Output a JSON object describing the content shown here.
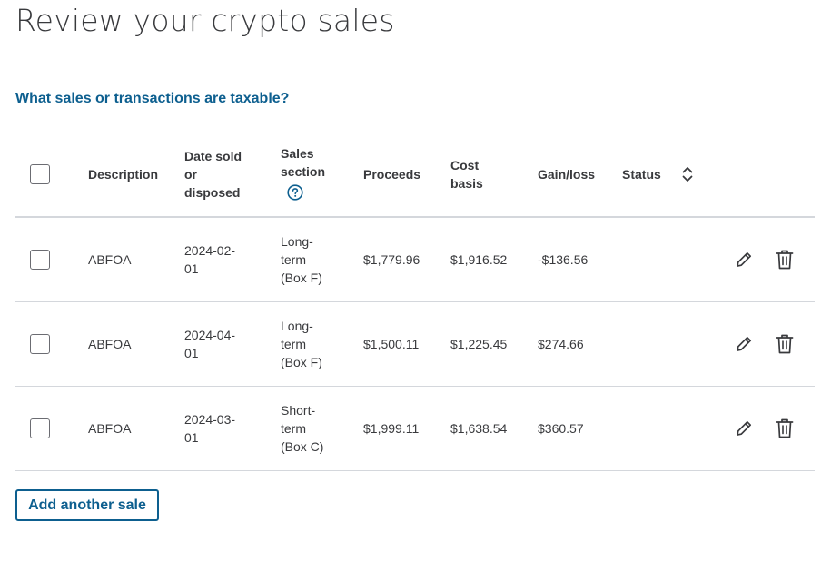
{
  "page": {
    "title": "Review your crypto sales",
    "help_link": "What sales or transactions are taxable?"
  },
  "table": {
    "columns": {
      "description": "Description",
      "date_sold_line1": "Date sold",
      "date_sold_line2": "or",
      "date_sold_line3": "disposed",
      "sales_section_line1": "Sales",
      "sales_section_line2": "section",
      "proceeds": "Proceeds",
      "cost_basis_line1": "Cost",
      "cost_basis_line2": "basis",
      "gain_loss": "Gain/loss",
      "status": "Status"
    },
    "rows": [
      {
        "description": "ABFOA",
        "date_line1": "2024-02-",
        "date_line2": "01",
        "section_line1": "Long-",
        "section_line2": "term",
        "section_line3": "(Box F)",
        "proceeds": "$1,779.96",
        "cost_basis": "$1,916.52",
        "gain_loss": "-$136.56",
        "status": ""
      },
      {
        "description": "ABFOA",
        "date_line1": "2024-04-",
        "date_line2": "01",
        "section_line1": "Long-",
        "section_line2": "term",
        "section_line3": "(Box F)",
        "proceeds": "$1,500.11",
        "cost_basis": "$1,225.45",
        "gain_loss": "$274.66",
        "status": ""
      },
      {
        "description": "ABFOA",
        "date_line1": "2024-03-",
        "date_line2": "01",
        "section_line1": "Short-",
        "section_line2": "term",
        "section_line3": "(Box C)",
        "proceeds": "$1,999.11",
        "cost_basis": "$1,638.54",
        "gain_loss": "$360.57",
        "status": ""
      }
    ]
  },
  "actions": {
    "add_another_sale": "Add another sale"
  },
  "icons": {
    "help": "question-circle-icon",
    "sort": "sort-updown-icon",
    "edit": "pencil-icon",
    "delete": "trash-icon"
  },
  "colors": {
    "link": "#0d5f8f",
    "text": "#393a3d",
    "divider": "#d4d7dc"
  }
}
